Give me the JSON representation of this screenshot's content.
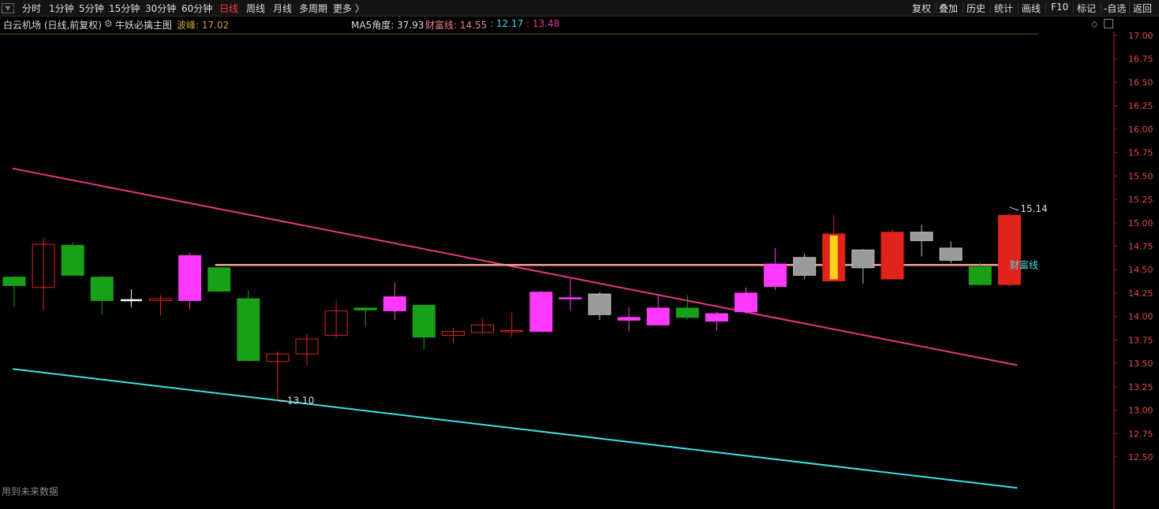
{
  "toolbar": {
    "menu_icon": "menu-icon",
    "tabs": [
      "分时",
      "1分钟",
      "5分钟",
      "15分钟",
      "30分钟",
      "60分钟",
      "日线",
      "周线",
      "月线",
      "多周期",
      "更多 〉"
    ],
    "active_tab": "日线",
    "right_buttons": [
      "复权",
      "叠加",
      "历史",
      "统计",
      "画线",
      "F10",
      "标记",
      "-自选",
      "返回"
    ]
  },
  "info": {
    "stock_title": "白云机场 (日线,前复权)",
    "indicator_name": "牛妖必擒主图",
    "wave_peak_label": "波峰: 17.02",
    "ma5_label": "MA5角度: 37.93",
    "caifu_label": "财富线: 14.55",
    "value2_label": ": 12.17",
    "value3_label": ": 13.48"
  },
  "footer_text": "用到未来数据",
  "colors": {
    "up_candle": "#e0241c",
    "down_candle": "#18a018",
    "magenta_candle": "#ff39ff",
    "gray_candle": "#9a9a9a",
    "pink_line": "#e8368c",
    "cyan_line": "#3ee0e8",
    "caifu_line": "#f5a08c",
    "axis_red": "#b22222"
  },
  "chart_data": {
    "type": "candlestick",
    "y_axis_ticks": [
      "17.00",
      "16.75",
      "16.50",
      "16.25",
      "16.00",
      "15.75",
      "15.50",
      "15.25",
      "15.00",
      "14.75",
      "14.50",
      "14.25",
      "14.00",
      "13.75",
      "13.50",
      "13.25",
      "13.00",
      "12.75",
      "12.50"
    ],
    "ylim": [
      12.0,
      17.05
    ],
    "x_slots": 36,
    "candles": [
      {
        "o": 14.33,
        "h": 14.43,
        "l": 14.1,
        "c": 14.42,
        "style": "down"
      },
      {
        "o": 14.31,
        "h": 14.84,
        "l": 14.06,
        "c": 14.77,
        "style": "up"
      },
      {
        "o": 14.76,
        "h": 14.79,
        "l": 14.44,
        "c": 14.44,
        "style": "down"
      },
      {
        "o": 14.42,
        "h": 14.43,
        "l": 14.02,
        "c": 14.17,
        "style": "down"
      },
      {
        "o": 14.17,
        "h": 14.29,
        "l": 14.1,
        "c": 14.18,
        "style": "doji_white"
      },
      {
        "o": 14.17,
        "h": 14.23,
        "l": 14.01,
        "c": 14.19,
        "style": "up"
      },
      {
        "o": 14.17,
        "h": 14.68,
        "l": 14.08,
        "c": 14.65,
        "style": "magenta"
      },
      {
        "o": 14.52,
        "h": 14.52,
        "l": 14.27,
        "c": 14.27,
        "style": "down"
      },
      {
        "o": 14.19,
        "h": 14.28,
        "l": 13.52,
        "c": 13.53,
        "style": "down"
      },
      {
        "o": 13.52,
        "h": 13.63,
        "l": 13.1,
        "c": 13.6,
        "style": "up"
      },
      {
        "o": 13.6,
        "h": 13.82,
        "l": 13.48,
        "c": 13.76,
        "style": "up"
      },
      {
        "o": 13.8,
        "h": 14.17,
        "l": 13.77,
        "c": 14.06,
        "style": "up"
      },
      {
        "o": 14.07,
        "h": 14.1,
        "l": 13.89,
        "c": 14.09,
        "style": "down"
      },
      {
        "o": 14.06,
        "h": 14.36,
        "l": 13.96,
        "c": 14.21,
        "style": "magenta"
      },
      {
        "o": 14.12,
        "h": 14.13,
        "l": 13.65,
        "c": 13.78,
        "style": "down"
      },
      {
        "o": 13.8,
        "h": 13.88,
        "l": 13.72,
        "c": 13.84,
        "style": "up"
      },
      {
        "o": 13.83,
        "h": 13.98,
        "l": 13.82,
        "c": 13.91,
        "style": "up"
      },
      {
        "o": 13.85,
        "h": 14.04,
        "l": 13.78,
        "c": 13.85,
        "style": "up"
      },
      {
        "o": 13.84,
        "h": 14.27,
        "l": 13.84,
        "c": 14.26,
        "style": "magenta"
      },
      {
        "o": 14.2,
        "h": 14.4,
        "l": 14.06,
        "c": 14.19,
        "style": "magenta"
      },
      {
        "o": 14.24,
        "h": 14.26,
        "l": 13.96,
        "c": 14.02,
        "style": "gray"
      },
      {
        "o": 13.96,
        "h": 14.1,
        "l": 13.84,
        "c": 13.99,
        "style": "magenta"
      },
      {
        "o": 13.91,
        "h": 14.22,
        "l": 13.9,
        "c": 14.09,
        "style": "magenta"
      },
      {
        "o": 14.09,
        "h": 14.23,
        "l": 13.97,
        "c": 13.99,
        "style": "down"
      },
      {
        "o": 13.95,
        "h": 14.05,
        "l": 13.85,
        "c": 14.03,
        "style": "magenta"
      },
      {
        "o": 14.05,
        "h": 14.31,
        "l": 14.03,
        "c": 14.25,
        "style": "magenta"
      },
      {
        "o": 14.32,
        "h": 14.73,
        "l": 14.28,
        "c": 14.56,
        "style": "magenta"
      },
      {
        "o": 14.44,
        "h": 14.67,
        "l": 14.4,
        "c": 14.63,
        "style": "gray"
      },
      {
        "o": 14.38,
        "h": 15.08,
        "l": 14.37,
        "c": 14.88,
        "style": "up_gold"
      },
      {
        "o": 14.52,
        "h": 14.72,
        "l": 14.35,
        "c": 14.71,
        "style": "gray"
      },
      {
        "o": 14.4,
        "h": 14.93,
        "l": 14.4,
        "c": 14.9,
        "style": "up_solid"
      },
      {
        "o": 14.9,
        "h": 14.98,
        "l": 14.64,
        "c": 14.81,
        "style": "gray"
      },
      {
        "o": 14.6,
        "h": 14.8,
        "l": 14.57,
        "c": 14.73,
        "style": "gray"
      },
      {
        "o": 14.53,
        "h": 14.58,
        "l": 14.33,
        "c": 14.34,
        "style": "down"
      },
      {
        "o": 14.34,
        "h": 15.1,
        "l": 14.32,
        "c": 15.08,
        "style": "up_solid"
      }
    ],
    "lines": [
      {
        "name": "pink_trend",
        "from": [
          0,
          15.58
        ],
        "to": [
          34,
          13.48
        ]
      },
      {
        "name": "cyan_trend",
        "from": [
          0,
          13.44
        ],
        "to": [
          34,
          12.17
        ]
      },
      {
        "name": "财富线",
        "from": [
          7,
          14.55
        ],
        "to": [
          34,
          14.55
        ]
      }
    ],
    "annotations": {
      "low_label": "13.10",
      "high_label": "15.14",
      "caifu_label": "财富线"
    }
  }
}
